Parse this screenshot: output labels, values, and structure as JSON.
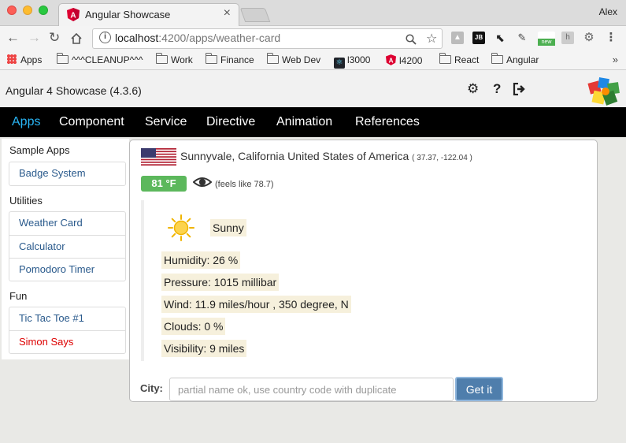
{
  "browser": {
    "tab_title": "Angular Showcase",
    "tab_close": "×",
    "user_name": "Alex",
    "url_host": "localhost",
    "url_rest": ":4200/apps/weather-card",
    "bookmarks": [
      {
        "label": "Apps",
        "icon": "apps-grid-icon"
      },
      {
        "label": "^^^CLEANUP^^^",
        "icon": "folder-icon"
      },
      {
        "label": "Work",
        "icon": "folder-icon"
      },
      {
        "label": "Finance",
        "icon": "folder-icon"
      },
      {
        "label": "Web Dev",
        "icon": "folder-icon"
      },
      {
        "label": "l3000",
        "icon": "react-icon"
      },
      {
        "label": "l4200",
        "icon": "angular-icon"
      },
      {
        "label": "React",
        "icon": "folder-icon"
      },
      {
        "label": "Angular",
        "icon": "folder-icon"
      }
    ],
    "bookmarks_more": "»"
  },
  "app": {
    "title": "Angular 4 Showcase (4.3.6)",
    "menu": [
      "Apps",
      "Component",
      "Service",
      "Directive",
      "Animation",
      "References"
    ],
    "active_menu": "Apps"
  },
  "sidebar": {
    "sections": [
      {
        "heading": "Sample Apps",
        "items": [
          {
            "label": "Badge System"
          }
        ]
      },
      {
        "heading": "Utilities",
        "items": [
          {
            "label": "Weather Card"
          },
          {
            "label": "Calculator"
          },
          {
            "label": "Pomodoro Timer"
          }
        ]
      },
      {
        "heading": "Fun",
        "items": [
          {
            "label": "Tic Tac Toe #1"
          },
          {
            "label": "Simon Says"
          }
        ]
      }
    ]
  },
  "weather": {
    "location": "Sunnyvale, California United States of America",
    "coords": "( 37.37, -122.04 )",
    "temperature": "81 °F",
    "feels_like": "(feels like 78.7)",
    "condition": "Sunny",
    "humidity": "Humidity: 26 %",
    "pressure": "Pressure: 1015 millibar",
    "wind": "Wind: 11.9 miles/hour , 350 degree, N",
    "clouds": "Clouds: 0 %",
    "visibility": "Visibility: 9 miles",
    "city_label": "City:",
    "city_placeholder": "partial name ok, use country code with duplicate",
    "button_label": "Get it",
    "colors": {
      "badge": "#5cb85c",
      "button": "#4f7eac",
      "menu_active": "#29b6f6"
    }
  }
}
